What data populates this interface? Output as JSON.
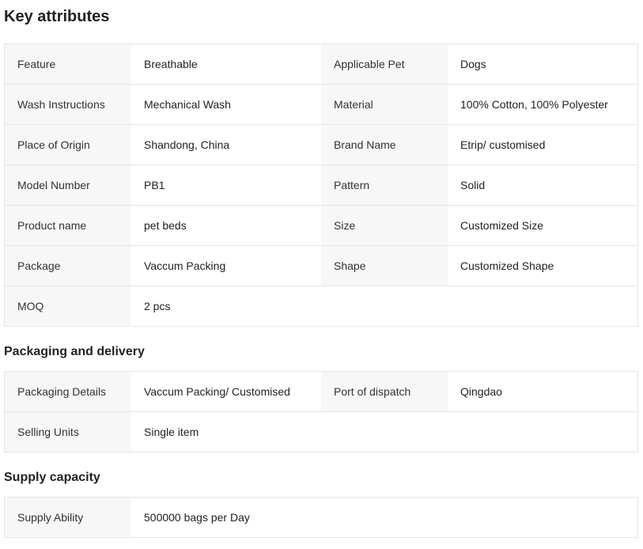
{
  "key_attributes": {
    "title": "Key attributes",
    "rows": [
      {
        "l1": "Feature",
        "v1": "Breathable",
        "l2": "Applicable Pet",
        "v2": "Dogs"
      },
      {
        "l1": "Wash Instructions",
        "v1": "Mechanical Wash",
        "l2": "Material",
        "v2": "100% Cotton, 100% Polyester"
      },
      {
        "l1": "Place of Origin",
        "v1": "Shandong, China",
        "l2": "Brand Name",
        "v2": "Etrip/ customised"
      },
      {
        "l1": "Model Number",
        "v1": "PB1",
        "l2": "Pattern",
        "v2": "Solid"
      },
      {
        "l1": "Product name",
        "v1": "pet beds",
        "l2": "Size",
        "v2": "Customized Size"
      },
      {
        "l1": "Package",
        "v1": "Vaccum Packing",
        "l2": "Shape",
        "v2": "Customized Shape"
      },
      {
        "l1": "MOQ",
        "v1": "2 pcs"
      }
    ]
  },
  "packaging": {
    "title": "Packaging and delivery",
    "rows": [
      {
        "l1": "Packaging Details",
        "v1": "Vaccum Packing/ Customised",
        "l2": "Port of dispatch",
        "v2": "Qingdao"
      },
      {
        "l1": "Selling Units",
        "v1": "Single item"
      }
    ]
  },
  "supply": {
    "title": "Supply capacity",
    "rows": [
      {
        "l1": "Supply Ability",
        "v1": "500000 bags per Day"
      }
    ]
  }
}
